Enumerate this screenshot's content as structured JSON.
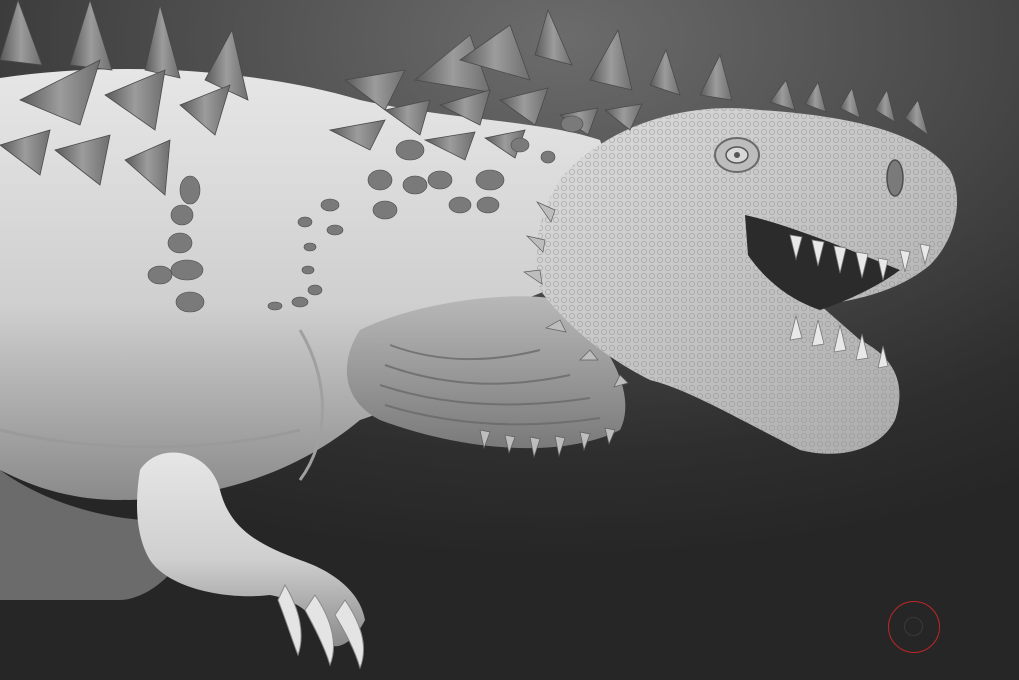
{
  "viewport": {
    "background_color": "#3a3a3a",
    "material_color": "#d6d6d6"
  },
  "model": {
    "subject": "dinosaur-sculpt",
    "render_style": "grayscale-matcap"
  },
  "cursor": {
    "type": "brush-circle-icon",
    "ring_color": "#c02626"
  }
}
